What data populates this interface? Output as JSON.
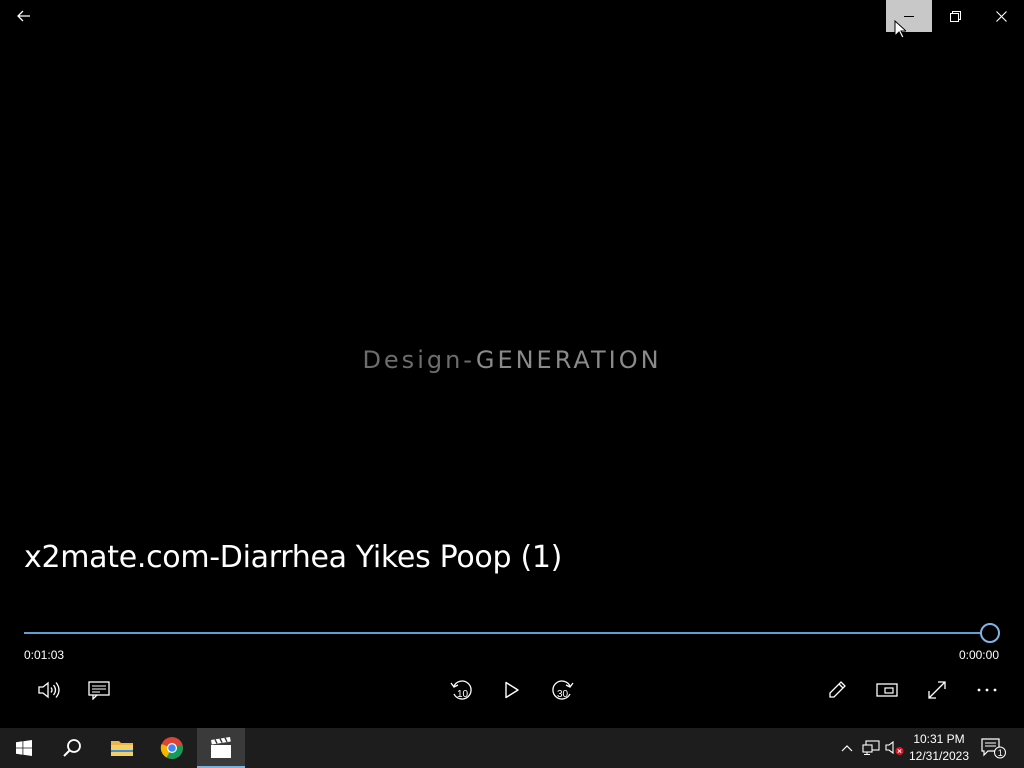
{
  "window": {
    "back_icon": "back-arrow-icon",
    "minimize_icon": "minimize-icon",
    "restore_icon": "restore-icon",
    "close_icon": "close-icon"
  },
  "video": {
    "frame_text_part1": "Design-",
    "frame_text_part2": "GENERATION"
  },
  "media": {
    "title": "x2mate.com-Diarrhea Yikes Poop (1)",
    "elapsed": "0:01:03",
    "remaining": "0:00:00",
    "progress": 1.0
  },
  "controls": {
    "volume_icon": "volume-icon",
    "captions_icon": "captions-icon",
    "skip_back_label": "10",
    "skip_forward_label": "30",
    "play_icon": "play-icon",
    "edit_icon": "pencil-icon",
    "mini_view_icon": "mini-view-icon",
    "fullscreen_icon": "fullscreen-icon",
    "more_icon": "more-icon"
  },
  "taskbar": {
    "apps": [
      "start",
      "search",
      "file-explorer",
      "chrome",
      "movies-and-tv"
    ],
    "clock_time": "10:31 PM",
    "clock_date": "12/31/2023",
    "notification_count": "1"
  },
  "colors": {
    "accent": "#5e9fd6",
    "taskbar": "#1d1d1d",
    "minimize_hover": "#c8c8c8"
  }
}
